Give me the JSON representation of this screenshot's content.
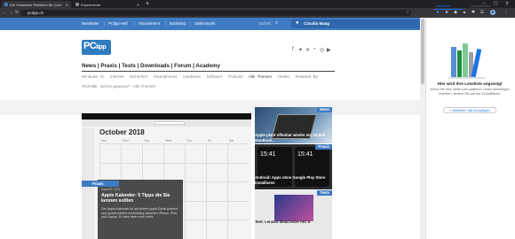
{
  "browser": {
    "tabs": [
      {
        "label": "Die Schweizer Plattform für Com",
        "favicon_color": "#3f7bc4"
      },
      {
        "label": "Experimente",
        "favicon_color": "#888888"
      }
    ],
    "new_tab": "+",
    "window_controls": [
      "–",
      "▢",
      "✕"
    ],
    "url": "pctipp.ch",
    "toolbar_icons": [
      "back-icon",
      "forward-icon",
      "reload-icon",
      "star-icon",
      "extensions-icon",
      "profile-icon",
      "menu-icon"
    ]
  },
  "site": {
    "topnav": [
      "Newsletter",
      "PCtipp-Heft",
      "Abonnement",
      "Bookshop",
      "Stellenmarkt"
    ],
    "search_placeholder": "Suchen",
    "user_name": "Claudia Maag",
    "logo_main": "PC",
    "logo_sub": "tipp",
    "social_icons": [
      "facebook-icon",
      "twitter-icon",
      "xing-icon",
      "rss-icon",
      "instagram-icon",
      "youtube-icon"
    ],
    "mainnav": [
      "News",
      "Praxis",
      "Tests",
      "Downloads",
      "Forum",
      "Academy"
    ],
    "subnav_row1": [
      "Windows 11",
      "Internet",
      "Sicherheit",
      "Smartphones",
      "Hardware",
      "Software",
      "Podcast",
      "Alle Themen",
      "Heimn",
      "Powered By"
    ],
    "subnav_row2": [
      "TechTalk",
      "Schon gewusst?",
      "Alle Themen"
    ],
    "feature": {
      "month": "October 2018",
      "weekdays": [
        "Sun",
        "Mon",
        "Tue",
        "Wed",
        "Thu",
        "Fri",
        "Sat"
      ],
      "category": "Praxis",
      "meta": "macOS / iOS",
      "title": "Apple Kalender: 5 Tipps die Sie kennen sollten",
      "teaser": "Der Apple-Kalender ist auf jedem Apple-Gerät präsent und synchronisiert zuverlässig zwischen iPhone, iPad und Laptop. Er kann aber noch mehr."
    },
    "side": [
      {
        "badge": "News",
        "title": "Apple plant offenbar wieder ein 16-Zoll MacBook..."
      },
      {
        "badge": "Praxis",
        "title": "Android: Apps ohne Google Play Store installieren",
        "time_left": "15:41",
        "time_right": "15:41"
      },
      {
        "badge": "Tests",
        "title": "Test: Lenovo IdeaCentre AIO 5"
      }
    ]
  },
  "reading_list": {
    "tabs": [
      "Leseliste",
      "Lesezeichen"
    ],
    "heading": "Hier wird Ihre Leseliste angezeigt",
    "description": "Wenn Sie eine Seite zum späteren Lesen hinzufügen möchten, klicken Sie auf die Schaltfläche.",
    "add_button": "+ Aktuellen Tab hinzufügen"
  }
}
